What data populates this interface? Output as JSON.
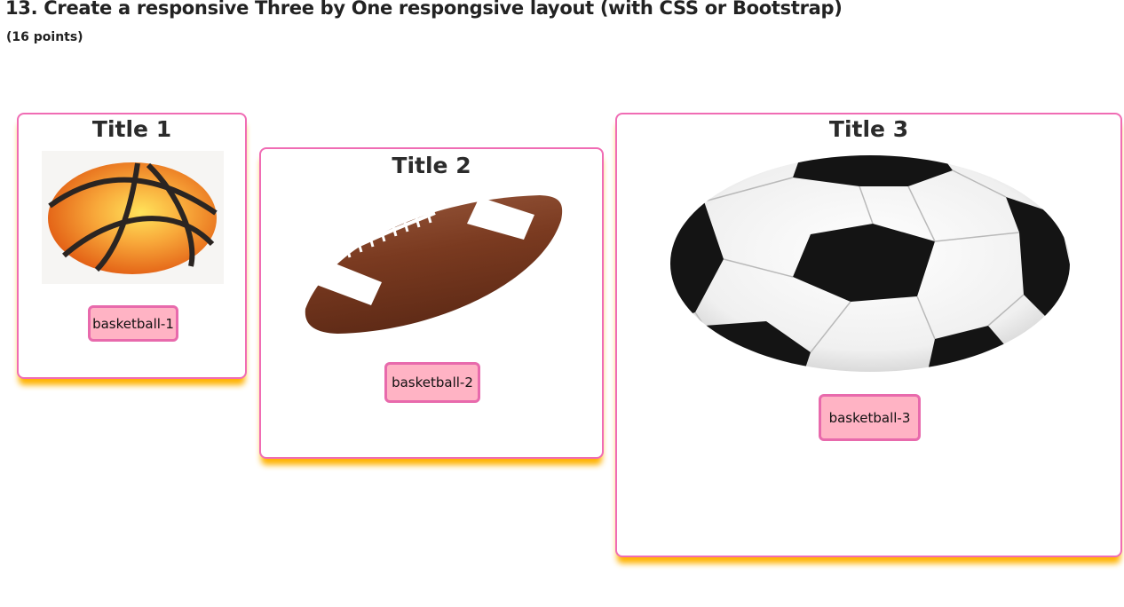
{
  "header": {
    "title": "13. Create a responsive Three by One respongsive layout (with CSS or Bootstrap)",
    "points": "(16 points)"
  },
  "cards": [
    {
      "title": "Title 1",
      "button": "basketball-1",
      "image": "basketball-image"
    },
    {
      "title": "Title 2",
      "button": "basketball-2",
      "image": "american-football-image"
    },
    {
      "title": "Title 3",
      "button": "basketball-3",
      "image": "soccer-ball-image"
    }
  ],
  "colors": {
    "card_border": "#f06cb4",
    "card_shadow": "#ffb300",
    "button_bg": "#ffb3c4",
    "button_border": "#e86aac"
  }
}
